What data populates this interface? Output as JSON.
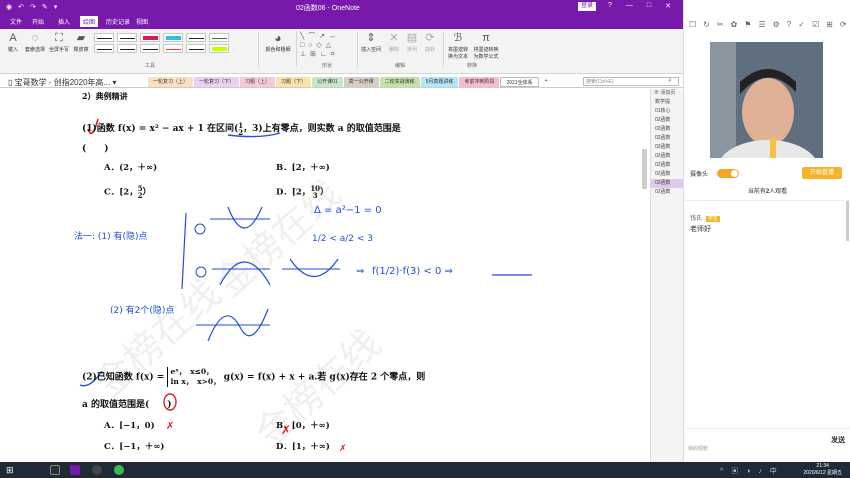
{
  "window": {
    "title": "02函数06 - OneNote",
    "login": "登录",
    "controls": [
      "?",
      "—",
      "□",
      "✕"
    ]
  },
  "menu": {
    "items": [
      {
        "label": "文件",
        "active": false
      },
      {
        "label": "开始",
        "active": false
      },
      {
        "label": "插入",
        "active": false
      },
      {
        "label": "绘图",
        "active": true
      },
      {
        "label": "历史记录",
        "active": false
      },
      {
        "label": "视图",
        "active": false
      }
    ]
  },
  "ribbon": {
    "tools_buttons": [
      "键入",
      "套索选择",
      "全屏手写",
      "橡皮擦"
    ],
    "tools_label": "工具",
    "color_button": "颜色和粗细",
    "shapes_label": "形状",
    "edit_buttons": [
      "插入空间",
      "删除",
      "排列",
      "旋转"
    ],
    "edit_label": "编辑",
    "convert_buttons": [
      "将墨迹转换为文本",
      "将墨迹转换为数学公式"
    ],
    "convert_label": "转换",
    "pen_colors": [
      "#222222",
      "#222222",
      "#222222",
      "#222222",
      "#d81b60",
      "#222222",
      "#26c6da",
      "#e53935",
      "#222222",
      "#222222",
      "#2e7d32",
      "#c6ff00"
    ]
  },
  "notebook": {
    "name": "宝哥数学 - 创指2020年高...",
    "tabs": [
      {
        "label": "一轮复习（上）",
        "color": "#f9e0c0"
      },
      {
        "label": "一轮复习（下）",
        "color": "#e8d0f0"
      },
      {
        "label": "习题（上）",
        "color": "#f6c9d8"
      },
      {
        "label": "习题（下）",
        "color": "#fbe2a8"
      },
      {
        "label": "公开课01",
        "color": "#c8e6c9"
      },
      {
        "label": "高一公开课",
        "color": "#d7ccc8"
      },
      {
        "label": "二轮实战演练",
        "color": "#c5e1a5"
      },
      {
        "label": "5月真题讲练",
        "color": "#b3e5fc"
      },
      {
        "label": "考前冲刺阶段",
        "color": "#f8bbd0"
      },
      {
        "label": "2021全体系",
        "color": "#ffffff"
      }
    ],
    "add_tab": "+",
    "search_placeholder": "搜索(Ctrl+E)"
  },
  "pages": {
    "add_page": "⊕ 添加页",
    "items": [
      {
        "label": "数学提",
        "selected": false
      },
      {
        "label": "01核心",
        "selected": false
      },
      {
        "label": "02函数",
        "selected": false
      },
      {
        "label": "02函数",
        "selected": false
      },
      {
        "label": "02函数",
        "selected": false
      },
      {
        "label": "02函数",
        "selected": false
      },
      {
        "label": "02函数",
        "selected": false
      },
      {
        "label": "02函数",
        "selected": false
      },
      {
        "label": "02函数",
        "selected": false
      },
      {
        "label": "02函数",
        "selected": true
      },
      {
        "label": "02函数",
        "selected": false
      }
    ]
  },
  "content": {
    "section": "2）典例精讲",
    "q1_prefix": "(1)函数 f(x) = x² − ax + 1 在区间",
    "q1_interval_open": "(",
    "q1_frac1_num": "1",
    "q1_frac1_den": "2",
    "q1_interval_sep": "，3",
    "q1_interval_close": ")",
    "q1_suffix": "上有零点，则实数 a 的取值范围是",
    "q1_paren": "(　　)",
    "q1_optA": "A．(2，＋∞)",
    "q1_optB": "B．[2，＋∞)",
    "q1_optC_pre": "C．[2，",
    "q1_optC_num": "5",
    "q1_optC_den": "2",
    "q1_optC_post": "）",
    "q1_optD_pre": "D．[2，",
    "q1_optD_num": "10",
    "q1_optD_den": "3",
    "q1_optD_post": "）",
    "q2_prefix": "(2)已知函数 f(x) =",
    "q2_case1": "eˣ，　x≤0，",
    "q2_case2": "ln x，　x>0，",
    "q2_suffix": "g(x) = f(x) + x + a.若 g(x)存在 2 个零点，则",
    "q2_line2": "a 的取值范围是(　　)",
    "q2_optA": "A．[−1，0)",
    "q2_optB": "B．[0，＋∞)",
    "q2_optC": "C．[−1，＋∞)",
    "q2_optD": "D．[1，＋∞)"
  },
  "handwriting": {
    "note1": "法一: (1) 有(隐)点",
    "eq1": "Δ = a²−1 = 0",
    "eq2": "1/2 < a/2 < 3",
    "eq3": "f(1/2)·f(3) < 0  ⇒",
    "note2": "(2) 有2个(隐)点",
    "wrong": "✗"
  },
  "watermark": "金榜在线",
  "live": {
    "camera_label": "摄像头",
    "start_button": "开始直播",
    "viewer_prefix": "当前有",
    "viewer_count": "2",
    "viewer_suffix": "人观看",
    "chat": [
      {
        "user": "钱氏",
        "badge": "学生",
        "message": "老师好"
      }
    ],
    "bottom_hint": "我的观帐",
    "send_button": "发送",
    "top_icons": [
      "☐",
      "↻",
      "✂",
      "✿",
      "⚑",
      "☰",
      "⚙",
      "?",
      "✓",
      "☑",
      "⊞",
      "⟳",
      "⚇",
      "✕"
    ]
  },
  "taskbar": {
    "time": "21:34",
    "date": "2020/6/12 星期五"
  }
}
